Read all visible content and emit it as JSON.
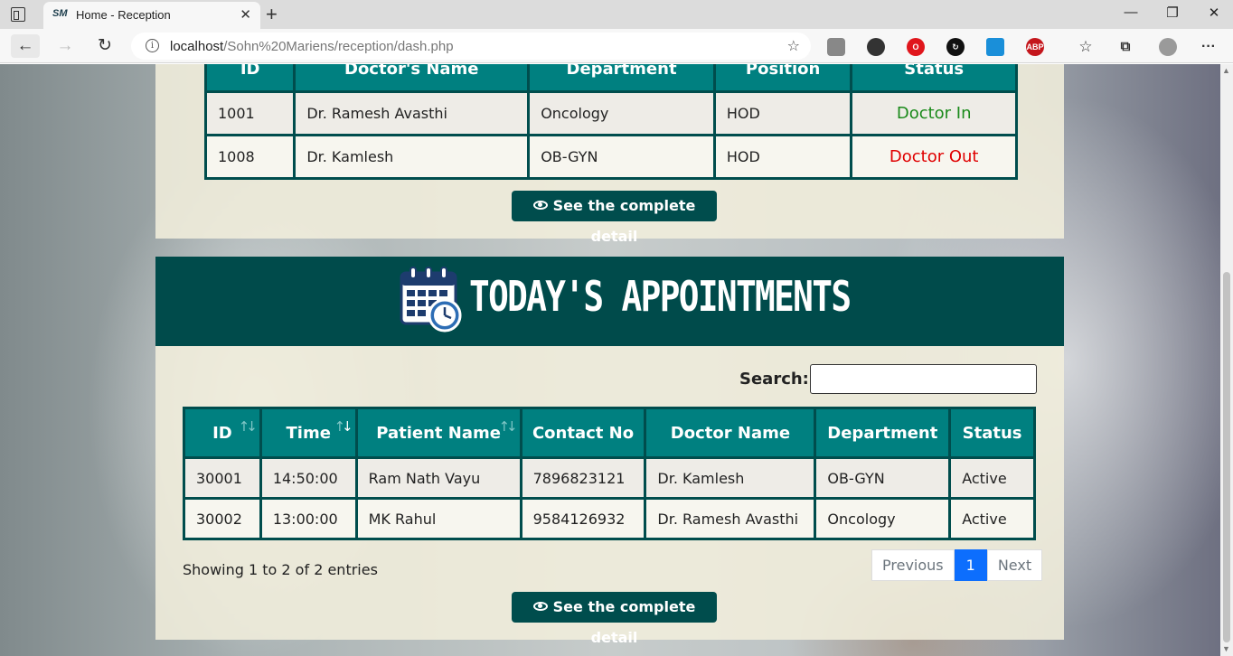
{
  "browser": {
    "tab_favicon": "SM",
    "tab_title": "Home - Reception",
    "url_host": "localhost",
    "url_path": "/Sohn%20Mariens/reception/dash.php",
    "extensions": [
      "extension-icon",
      "extension-icon",
      "opera-icon",
      "sync-icon",
      "screenshot-icon",
      "adblock-icon"
    ],
    "adblock_label": "ABP"
  },
  "doctors_table": {
    "headers": [
      "ID",
      "Doctor's Name",
      "Department",
      "Position",
      "Status"
    ],
    "rows": [
      {
        "id": "1001",
        "name": "Dr. Ramesh Avasthi",
        "department": "Oncology",
        "position": "HOD",
        "status": "Doctor In",
        "status_color": "#1a8a1a"
      },
      {
        "id": "1008",
        "name": "Dr. Kamlesh",
        "department": "OB-GYN",
        "position": "HOD",
        "status": "Doctor Out",
        "status_color": "#e00000"
      }
    ]
  },
  "detail_button_label": "See the complete detail",
  "appointments": {
    "title": "TODAY'S APPOINTMENTS",
    "search_label": "Search:",
    "search_value": "",
    "headers": [
      "ID",
      "Time",
      "Patient Name",
      "Contact No",
      "Doctor Name",
      "Department",
      "Status"
    ],
    "rows": [
      {
        "id": "30001",
        "time": "14:50:00",
        "patient": "Ram Nath Vayu",
        "contact": "7896823121",
        "doctor": "Dr. Kamlesh",
        "department": "OB-GYN",
        "status": "Active"
      },
      {
        "id": "30002",
        "time": "13:00:00",
        "patient": "MK Rahul",
        "contact": "9584126932",
        "doctor": "Dr. Ramesh Avasthi",
        "department": "Oncology",
        "status": "Active"
      }
    ],
    "info": "Showing 1 to 2 of 2 entries",
    "pager": {
      "previous": "Previous",
      "current": "1",
      "next": "Next"
    }
  },
  "colors": {
    "teal_header": "#008080",
    "dark_teal": "#004d4d",
    "pager_active": "#0d6efd"
  }
}
